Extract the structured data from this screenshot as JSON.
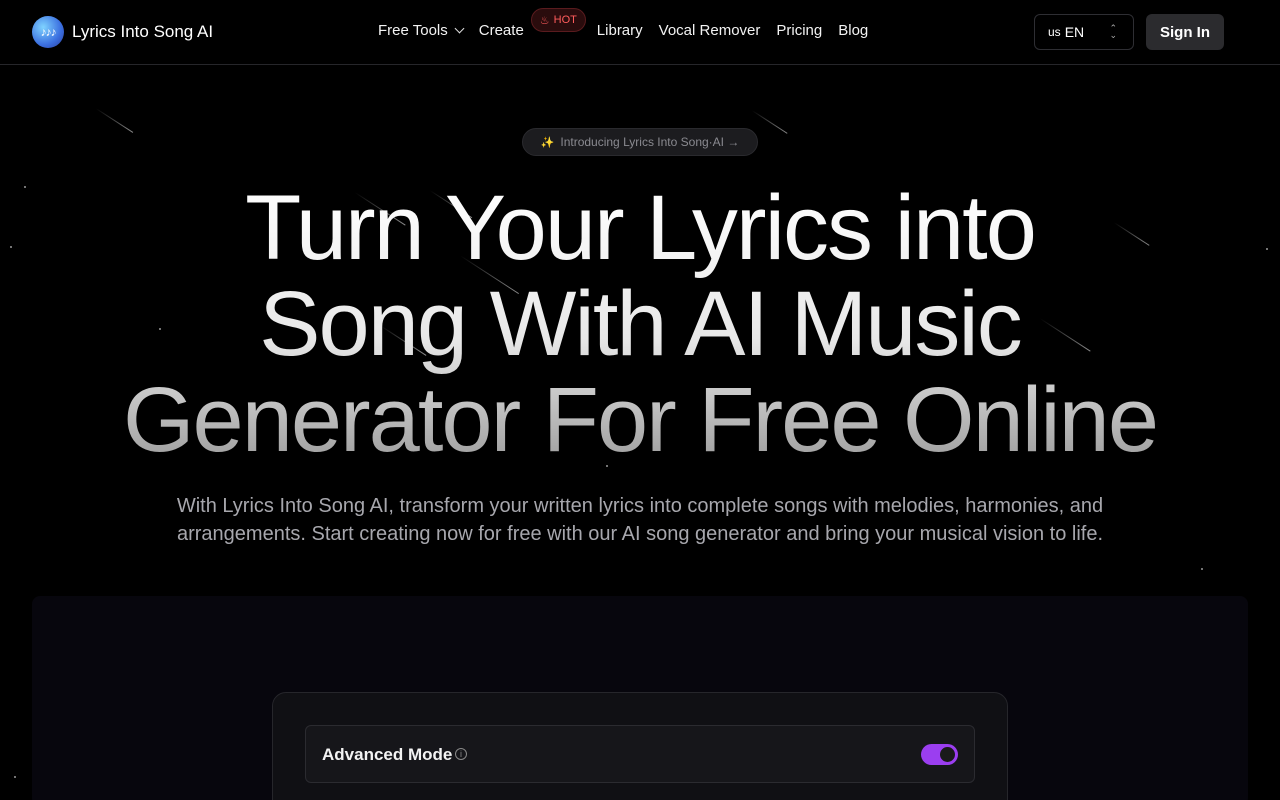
{
  "brand": {
    "name": "Lyrics Into Song AI",
    "logo_text": "♪♪♪"
  },
  "nav": {
    "items": [
      {
        "label": "Free Tools"
      },
      {
        "label": "Create"
      },
      {
        "label": "Library"
      },
      {
        "label": "Vocal Remover"
      },
      {
        "label": "Pricing"
      },
      {
        "label": "Blog"
      }
    ],
    "hot_badge": "HOT",
    "language_country": "us",
    "language_code": "EN",
    "sign_in": "Sign In"
  },
  "hero": {
    "pill": "Introducing Lyrics Into Song·AI →",
    "headline_line1": "Turn Your Lyrics into",
    "headline_line2": "Song With AI Music",
    "headline_line3": "Generator For Free Online",
    "subtitle": "With Lyrics Into Song AI, transform your written lyrics into complete songs with melodies, harmonies, and arrangements. Start creating now for free with our AI song generator and bring your musical vision to life."
  },
  "generator": {
    "advanced_mode_label": "Advanced Mode",
    "advanced_mode_enabled": true
  },
  "colors": {
    "accent": "#9b3ef0",
    "hot": "#ff5c5c",
    "background": "#000000"
  }
}
